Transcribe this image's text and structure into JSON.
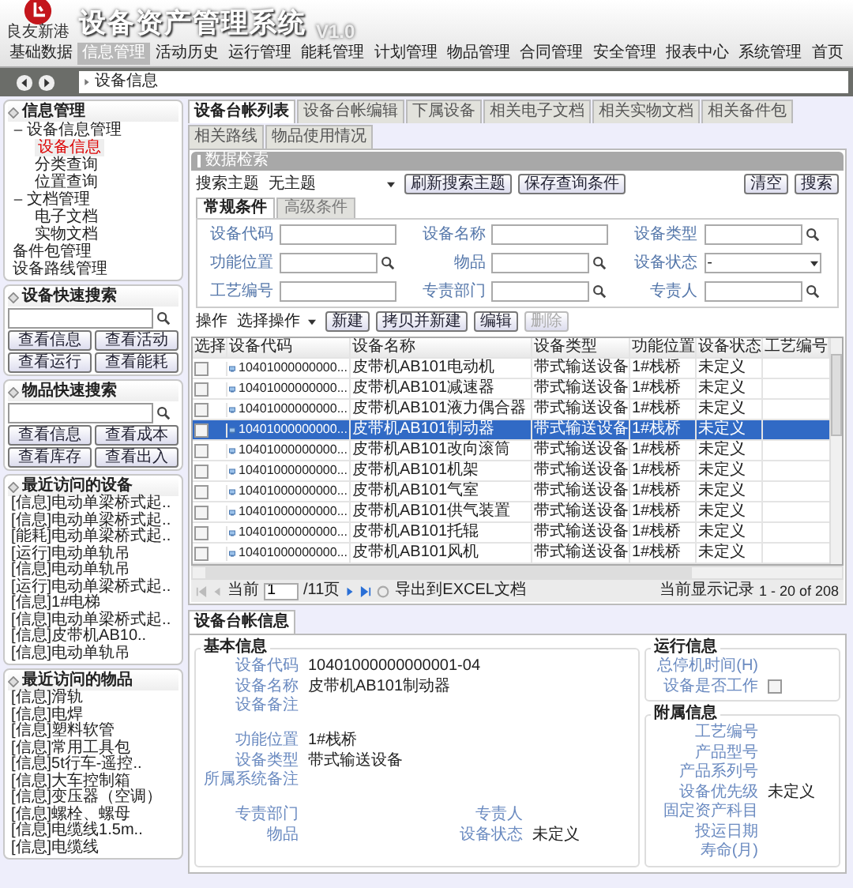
{
  "header": {
    "logo_text": "良友新港",
    "title": "设备资产管理系统",
    "version": "V1.0"
  },
  "menu": [
    {
      "label": "基础数据",
      "selected": false
    },
    {
      "label": "信息管理",
      "selected": true
    },
    {
      "label": "活动历史",
      "selected": false
    },
    {
      "label": "运行管理",
      "selected": false
    },
    {
      "label": "能耗管理",
      "selected": false
    },
    {
      "label": "计划管理",
      "selected": false
    },
    {
      "label": "物品管理",
      "selected": false
    },
    {
      "label": "合同管理",
      "selected": false
    },
    {
      "label": "安全管理",
      "selected": false
    },
    {
      "label": "报表中心",
      "selected": false
    },
    {
      "label": "系统管理",
      "selected": false
    }
  ],
  "home": "首页",
  "breadcrumb": "设备信息",
  "sidebar": {
    "nav": {
      "title": "信息管理",
      "items": [
        {
          "label": "设备信息管理",
          "selected": false,
          "expanded": true,
          "children": [
            {
              "label": "设备信息",
              "selected": true
            },
            {
              "label": "分类查询",
              "selected": false
            },
            {
              "label": "位置查询",
              "selected": false
            }
          ]
        },
        {
          "label": "文档管理",
          "selected": false,
          "expanded": true,
          "children": [
            {
              "label": "电子文档",
              "selected": false
            },
            {
              "label": "实物文档",
              "selected": false
            }
          ]
        },
        {
          "label": "备件包管理",
          "selected": false
        },
        {
          "label": "设备路线管理",
          "selected": false
        }
      ]
    },
    "device_search": {
      "title": "设备快速搜索",
      "buttons": [
        "查看信息",
        "查看活动",
        "查看运行",
        "查看能耗"
      ]
    },
    "item_search": {
      "title": "物品快速搜索",
      "buttons": [
        "查看信息",
        "查看成本",
        "查看库存",
        "查看出入"
      ]
    },
    "recent_devices": {
      "title": "最近访问的设备",
      "items": [
        "[信息]电动单梁桥式起..",
        "[信息]电动单梁桥式起..",
        "[能耗]电动单梁桥式起..",
        "[运行]电动单轨吊",
        "[信息]电动单轨吊",
        "[运行]电动单梁桥式起..",
        "[信息]1#电梯",
        "[信息]电动单梁桥式起..",
        "[信息]皮带机AB10..",
        "[信息]电动单轨吊"
      ]
    },
    "recent_items": {
      "title": "最近访问的物品",
      "items": [
        "[信息]滑轨",
        "[信息]电焊",
        "[信息]塑料软管",
        "[信息]常用工具包",
        "[信息]5t行车-遥控..",
        "[信息]大车控制箱",
        "[信息]变压器（空调）",
        "[信息]螺栓、螺母",
        "[信息]电缆线1.5m..",
        "[信息]电缆线"
      ]
    }
  },
  "tabs": [
    {
      "label": "设备台帐列表",
      "selected": true
    },
    {
      "label": "设备台帐编辑",
      "selected": false
    },
    {
      "label": "下属设备",
      "selected": false
    },
    {
      "label": "相关电子文档",
      "selected": false
    },
    {
      "label": "相关实物文档",
      "selected": false
    },
    {
      "label": "相关备件包",
      "selected": false
    },
    {
      "label": "相关路线",
      "selected": false
    },
    {
      "label": "物品使用情况",
      "selected": false
    }
  ],
  "search": {
    "title": "数据检索",
    "theme_label": "搜索主题",
    "theme_value": "无主题",
    "buttons": [
      "刷新搜索主题",
      "保存查询条件"
    ],
    "right_buttons": [
      "清空",
      "搜索"
    ],
    "subtabs": [
      {
        "label": "常规条件",
        "selected": true
      },
      {
        "label": "高级条件",
        "selected": false
      }
    ],
    "fields": [
      {
        "label": "设备代码",
        "kind": "text"
      },
      {
        "label": "设备名称",
        "kind": "text"
      },
      {
        "label": "设备类型",
        "kind": "lookup"
      },
      {
        "label": "功能位置",
        "kind": "lookup"
      },
      {
        "label": "物品",
        "kind": "lookup"
      },
      {
        "label": "设备状态",
        "kind": "select",
        "selection": "-"
      },
      {
        "label": "工艺编号",
        "kind": "text"
      },
      {
        "label": "专责部门",
        "kind": "lookup"
      },
      {
        "label": "专责人",
        "kind": "lookup"
      }
    ]
  },
  "actions": {
    "label": "操作",
    "select": "选择操作",
    "buttons": [
      {
        "label": "新建",
        "disabled": false
      },
      {
        "label": "拷贝并新建",
        "disabled": false
      },
      {
        "label": "编辑",
        "disabled": false
      },
      {
        "label": "删除",
        "disabled": true
      }
    ]
  },
  "table": {
    "columns": [
      "选择",
      "设备代码",
      "设备名称",
      "设备类型",
      "功能位置",
      "设备状态",
      "工艺编号"
    ],
    "rows": [
      {
        "checked": false,
        "selected": false,
        "cells": [
          "",
          "10401000000000...",
          "皮带机AB101电动机",
          "带式输送设备",
          "1#栈桥",
          "未定义",
          ""
        ]
      },
      {
        "checked": false,
        "selected": false,
        "cells": [
          "",
          "10401000000000...",
          "皮带机AB101减速器",
          "带式输送设备",
          "1#栈桥",
          "未定义",
          ""
        ]
      },
      {
        "checked": false,
        "selected": false,
        "cells": [
          "",
          "10401000000000...",
          "皮带机AB101液力偶合器",
          "带式输送设备",
          "1#栈桥",
          "未定义",
          ""
        ]
      },
      {
        "checked": false,
        "selected": true,
        "cells": [
          "",
          "10401000000000...",
          "皮带机AB101制动器",
          "带式输送设备",
          "1#栈桥",
          "未定义",
          ""
        ]
      },
      {
        "checked": false,
        "selected": false,
        "cells": [
          "",
          "10401000000000...",
          "皮带机AB101改向滚筒",
          "带式输送设备",
          "1#栈桥",
          "未定义",
          ""
        ]
      },
      {
        "checked": false,
        "selected": false,
        "cells": [
          "",
          "10401000000000...",
          "皮带机AB101机架",
          "带式输送设备",
          "1#栈桥",
          "未定义",
          ""
        ]
      },
      {
        "checked": false,
        "selected": false,
        "cells": [
          "",
          "10401000000000...",
          "皮带机AB101气室",
          "带式输送设备",
          "1#栈桥",
          "未定义",
          ""
        ]
      },
      {
        "checked": false,
        "selected": false,
        "cells": [
          "",
          "10401000000000...",
          "皮带机AB101供气装置",
          "带式输送设备",
          "1#栈桥",
          "未定义",
          ""
        ]
      },
      {
        "checked": false,
        "selected": false,
        "cells": [
          "",
          "10401000000000...",
          "皮带机AB101托辊",
          "带式输送设备",
          "1#栈桥",
          "未定义",
          ""
        ]
      },
      {
        "checked": false,
        "selected": false,
        "cells": [
          "",
          "10401000000000...",
          "皮带机AB101风机",
          "带式输送设备",
          "1#栈桥",
          "未定义",
          ""
        ]
      }
    ]
  },
  "pager": {
    "prefix": "当前",
    "page": "1",
    "total": "/11页",
    "export": "导出到EXCEL文档",
    "records_label": "当前显示记录",
    "records": "1 - 20 of 208"
  },
  "detail": {
    "tab": "设备台帐信息",
    "basic": {
      "title": "基本信息",
      "fields": [
        {
          "label": "设备代码",
          "value": "10401000000000001-04",
          "kind": "field"
        },
        {
          "label": "设备名称",
          "value": "皮带机AB101制动器",
          "kind": "field"
        },
        {
          "label": "设备备注",
          "kind": "note"
        },
        {
          "label": "功能位置",
          "value": "1#栈桥",
          "kind": "field"
        },
        {
          "label": "设备类型",
          "value": "带式输送设备",
          "kind": "field"
        },
        {
          "label": "所属系统备注",
          "kind": "note"
        }
      ],
      "pairs": [
        [
          {
            "label": "专责部门"
          },
          {
            "label": "专责人"
          }
        ],
        [
          {
            "label": "物品"
          },
          {
            "label": "设备状态",
            "value": "未定义"
          }
        ]
      ]
    },
    "running": {
      "title": "运行信息",
      "fields": [
        {
          "label": "总停机时间(H)",
          "kind": "text"
        },
        {
          "label": "设备是否工作",
          "kind": "checkbox",
          "checked": false
        }
      ]
    },
    "attached": {
      "title": "附属信息",
      "fields": [
        {
          "label": "工艺编号"
        },
        {
          "label": "产品型号"
        },
        {
          "label": "产品系列号"
        },
        {
          "label": "设备优先级",
          "value": "未定义"
        },
        {
          "label": "固定资产科目"
        },
        {
          "label": "投运日期"
        },
        {
          "label": "寿命(月)"
        }
      ]
    }
  }
}
